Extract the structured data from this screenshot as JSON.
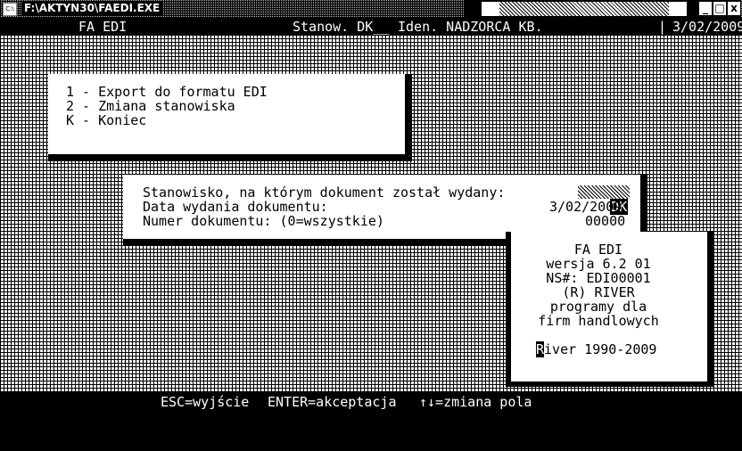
{
  "window": {
    "app_icon": "C:\\",
    "title": "F:\\AKTYN30\\FAEDI.EXE",
    "minimize": "_",
    "maximize": "□",
    "close": "x"
  },
  "header": {
    "app_name": "FA EDI",
    "station_label": "Stanow. DK__",
    "ident_label": "Iden. NADZORCA KB.",
    "date": "3/02/2009"
  },
  "menu": {
    "items": [
      {
        "key": "1",
        "label": "1 - Export do formatu EDI"
      },
      {
        "key": "2",
        "label": "2 - Zmiana stanowiska"
      },
      {
        "key": "K",
        "label": "K - Koniec"
      }
    ]
  },
  "form": {
    "station_label": "Stanowisko, na którym dokument został wydany:",
    "station_value": "DK",
    "date_label": "Data wydania dokumentu:",
    "date_value": "3/02/2009",
    "number_label": "Numer dokumentu: (0=wszystkie)",
    "number_value": "00000"
  },
  "info": {
    "line1": "FA EDI",
    "line2": "wersja 6.2 01",
    "line3": "NS#: EDI00001",
    "line4": "(R) RIVER",
    "line5": "programy dla",
    "line6": "firm handlowych",
    "copyright_initial": "R",
    "copyright_rest": "iver 1990-2009"
  },
  "statusbar": {
    "esc": "ESC=wyjście",
    "enter": "ENTER=akceptacja",
    "arrows": "↑↓=zmiana pola"
  }
}
